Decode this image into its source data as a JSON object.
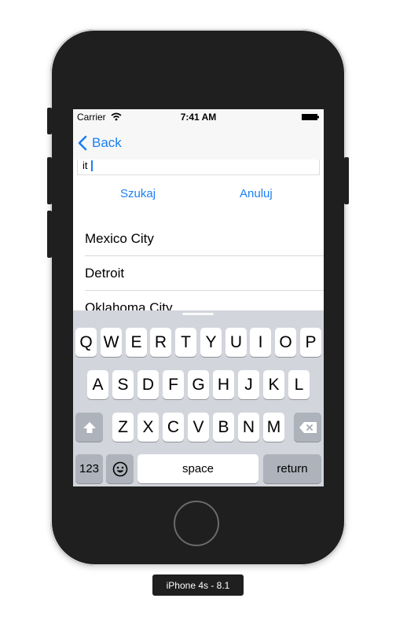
{
  "status_bar": {
    "carrier": "Carrier",
    "time": "7:41 AM"
  },
  "nav": {
    "back_label": "Back"
  },
  "search": {
    "value": "it"
  },
  "actions": {
    "search_label": "Szukaj",
    "cancel_label": "Anuluj"
  },
  "results": [
    "Mexico City",
    "Detroit",
    "Oklahoma City"
  ],
  "keyboard": {
    "row1": [
      "Q",
      "W",
      "E",
      "R",
      "T",
      "Y",
      "U",
      "I",
      "O",
      "P"
    ],
    "row2": [
      "A",
      "S",
      "D",
      "F",
      "G",
      "H",
      "J",
      "K",
      "L"
    ],
    "row3": [
      "Z",
      "X",
      "C",
      "V",
      "B",
      "N",
      "M"
    ],
    "numbers_label": "123",
    "space_label": "space",
    "return_label": "return"
  },
  "device_label": "iPhone 4s - 8.1",
  "colors": {
    "accent": "#1a7ff5",
    "keyboard_bg": "#d2d5db",
    "device_body": "#1f1f1f"
  }
}
